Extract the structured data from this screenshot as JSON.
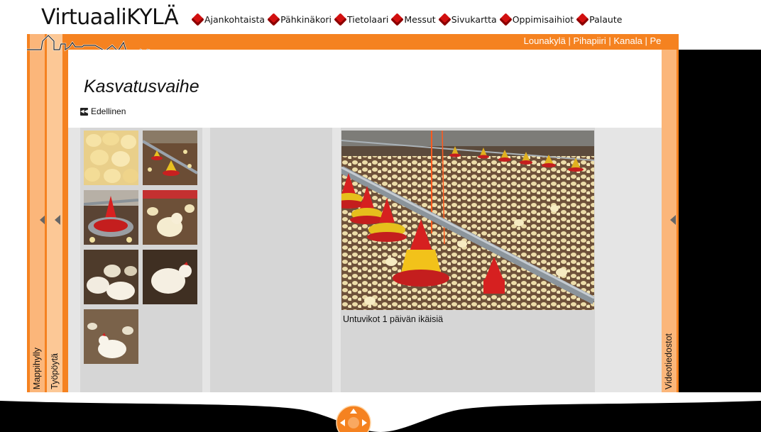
{
  "header": {
    "logo": "VirtuaaliKYLÄ",
    "nav": [
      "Ajankohtaista",
      "Pähkinäkori",
      "Tietolaari",
      "Messut",
      "Sivukartta",
      "Oppimisaihiot",
      "Palaute"
    ]
  },
  "breadcrumb": {
    "items": [
      "Lounakylä",
      "Pihapiiri",
      "Kanala",
      "Pellot"
    ],
    "separator": " | "
  },
  "side": {
    "left1": "Mappihylly",
    "left2": "Työpöytä",
    "right": "Videotiedostot"
  },
  "page": {
    "title": "Kasvatusvaihe",
    "prev_label": "Edellinen"
  },
  "gallery": {
    "caption": "Untuvikot 1 päivän ikäisiä",
    "thumbnail_count": 7
  },
  "colors": {
    "frame": "#f58220",
    "nav_cube": "#d21010"
  }
}
